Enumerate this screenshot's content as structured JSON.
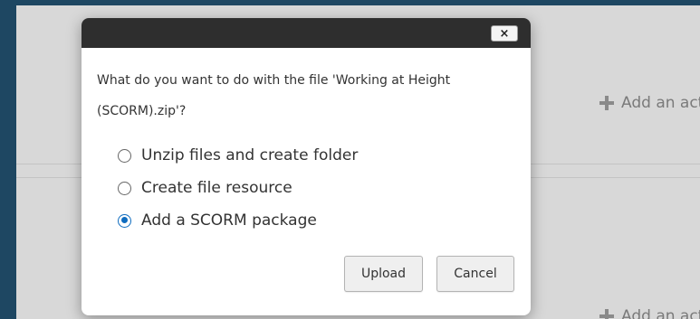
{
  "background": {
    "add_activity_label": "Add an activity or resource"
  },
  "dialog": {
    "close_label": "×",
    "message": "What do you want to do with the file 'Working at Height (SCORM).zip'?",
    "options": [
      {
        "label": "Unzip files and create folder",
        "selected": false
      },
      {
        "label": "Create file resource",
        "selected": false
      },
      {
        "label": "Add a SCORM package",
        "selected": true
      }
    ],
    "buttons": {
      "upload": "Upload",
      "cancel": "Cancel"
    }
  },
  "colors": {
    "outer_background": "#1e4762",
    "page_background": "#d8d8d8",
    "header": "#2e2e2e",
    "radio_selected": "#0f6cbf"
  }
}
